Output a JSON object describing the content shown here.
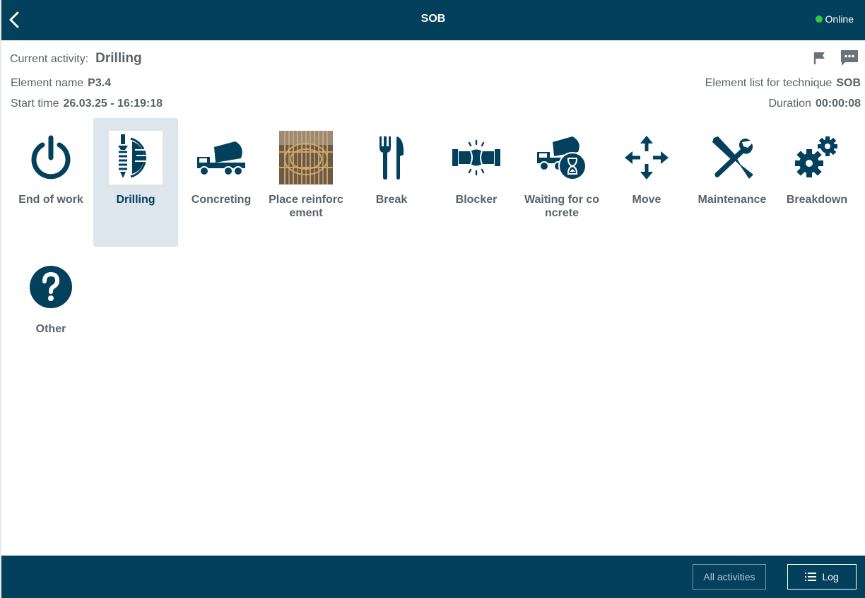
{
  "header": {
    "title": "SOB",
    "status": "Online",
    "status_color": "#2ecc40",
    "brand_color": "#03405c"
  },
  "info": {
    "current_activity_label": "Current activity:",
    "current_activity_value": "Drilling",
    "element_name_label": "Element name",
    "element_name_value": "P3.4",
    "start_time_label": "Start time",
    "start_time_value": "26.03.25 - 16:19:18",
    "element_list_label": "Element list for technique",
    "element_list_value": "SOB",
    "duration_label": "Duration",
    "duration_value": "00:00:08"
  },
  "activities": [
    {
      "label": "End of work",
      "icon": "power-icon"
    },
    {
      "label": "Drilling",
      "icon": "drilling-icon",
      "selected": true
    },
    {
      "label": "Concreting",
      "icon": "concrete-mixer-icon"
    },
    {
      "label": "Place reinforcement",
      "icon": "reinforcement-photo"
    },
    {
      "label": "Break",
      "icon": "fork-knife-icon"
    },
    {
      "label": "Blocker",
      "icon": "blocker-pipe-icon"
    },
    {
      "label": "Waiting for concrete",
      "icon": "mixer-hourglass-icon"
    },
    {
      "label": "Move",
      "icon": "move-arrows-icon"
    },
    {
      "label": "Maintenance",
      "icon": "wrench-screwdriver-icon"
    },
    {
      "label": "Breakdown",
      "icon": "gears-icon"
    },
    {
      "label": "Other",
      "icon": "question-icon"
    }
  ],
  "footer": {
    "all_activities_label": "All activities",
    "log_label": "Log"
  }
}
